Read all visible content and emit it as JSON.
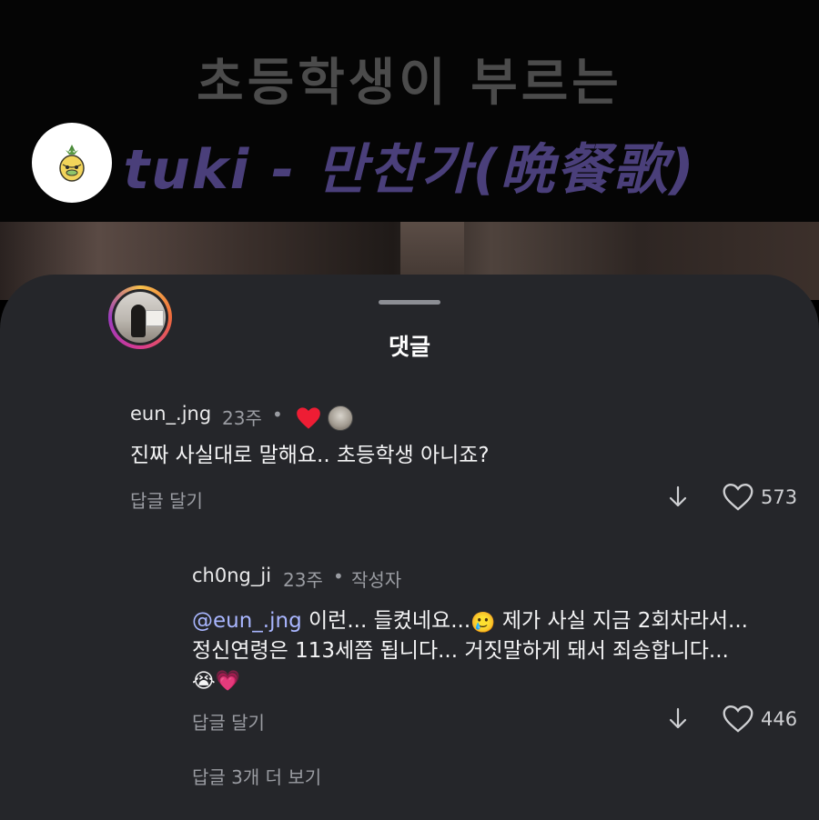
{
  "video": {
    "title_line1": "초등학생이 부르는",
    "title_line2": "tuki - 만찬가(晩餐歌)"
  },
  "sheet": {
    "title": "댓글"
  },
  "comments": [
    {
      "username": "eun_.jng",
      "age": "23주",
      "separator": "•",
      "text": "진짜 사실대로 말해요.. 초등학생 아니죠?",
      "reply_label": "답글 달기",
      "likes": "573",
      "creator_liked": true,
      "avatar_icon": "pineapple-character-icon"
    }
  ],
  "reply": {
    "username": "ch0ng_ji",
    "age": "23주",
    "separator": "•",
    "badge": "작성자",
    "mention": "@eun_.jng",
    "text_part1": " 이런... 들켰네요...",
    "emoji1": "🥲",
    "text_part2": " 제가 사실 지금 2회차라서...",
    "text_line2": "정신연령은 113세쯤 됩니다... 거짓말하게 돼서 죄송합니다...",
    "emoji_line3": "😭💗",
    "reply_label": "답글 달기",
    "likes": "446"
  },
  "more_replies": "답글 3개 더 보기",
  "colors": {
    "sheet_bg": "#25262a",
    "mention": "#a9b6ff",
    "heart_red": "#ee1d34",
    "title_purple": "#4a3f7a"
  }
}
